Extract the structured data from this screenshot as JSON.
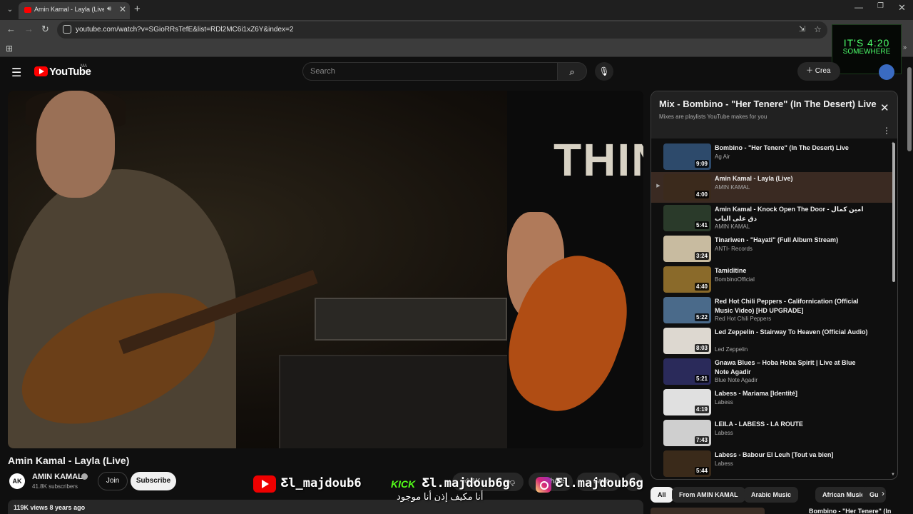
{
  "browser": {
    "tab_title": "Amin Kamal - Layla (Live) -",
    "url": "youtube.com/watch?v=SGioRRsTefE&list=RDl2MC6i1xZ6Y&index=2"
  },
  "overlay": {
    "line1": "IT'S 4:20",
    "line2": "SOMEWHERE"
  },
  "header": {
    "logo_text": "YouTube",
    "country": "MA",
    "search_placeholder": "Search",
    "create_label": "Crea"
  },
  "video": {
    "shirt_text": "THIN",
    "title": "Amin Kamal - Layla (Live)",
    "channel": {
      "avatar_text": "AK",
      "name": "AMIN KAMAL",
      "subscribers": "41.8K subscribers",
      "join_label": "Join",
      "subscribe_label": "Subscribe"
    },
    "actions": {
      "like": "1K",
      "share": "Share",
      "save": "Save"
    },
    "meta": "119K views  8 years ago"
  },
  "watermark": {
    "yt_handle": "Ƹl_majdoub6",
    "kick_label": "KICK",
    "kick_handle": "Ƹl.majdoub6g",
    "ig_handle": "Ƹl.majdoub6g",
    "arabic": "أنا مكيف إذن أنا موجود"
  },
  "playlist": {
    "title": "Mix - Bombino - \"Her Tenere\" (In The Desert) Live",
    "subtitle": "Mixes are playlists YouTube makes for you",
    "items": [
      {
        "title": "Bombino - \"Her Tenere\" (In The Desert) Live",
        "channel": "Ag Air",
        "duration": "9:09",
        "color": "#2d4a6b"
      },
      {
        "title": "Amin Kamal - Layla (Live)",
        "channel": "AMIN KAMAL",
        "duration": "4:00",
        "color": "#3b2a1c",
        "active": true
      },
      {
        "title": "Amin Kamal - Knock Open The Door امين كمال - دق على الباب",
        "channel": "AMIN KAMAL",
        "duration": "5:41",
        "color": "#2a3a2a"
      },
      {
        "title": "Tinariwen - \"Hayati\" (Full Album Stream)",
        "channel": "ANTI- Records",
        "duration": "3:24",
        "color": "#c8bba0"
      },
      {
        "title": "Tamiditine",
        "channel": "BombinoOfficial",
        "duration": "4:40",
        "color": "#8a6a2a"
      },
      {
        "title": "Red Hot Chili Peppers - Californication (Official Music Video) [HD UPGRADE]",
        "channel": "Red Hot Chili Peppers",
        "duration": "5:22",
        "color": "#4a6a8a"
      },
      {
        "title": "Led Zeppelin - Stairway To Heaven (Official Audio)",
        "channel": "Led Zeppelin",
        "duration": "8:03",
        "color": "#ddd8d0"
      },
      {
        "title": "Gnawa Blues – Hoba Hoba Spirit | Live at Blue Note Agadir",
        "channel": "Blue Note Agadir",
        "duration": "5:21",
        "color": "#2a2a5a"
      },
      {
        "title": "Labess - Mariama [Identité]",
        "channel": "Labess",
        "duration": "4:19",
        "color": "#e0e0e0"
      },
      {
        "title": "LEILA - LABESS - LA ROUTE",
        "channel": "Labess",
        "duration": "7:43",
        "color": "#cfcfcf"
      },
      {
        "title": "Labess - Babour El Leuh [Tout va bien]",
        "channel": "Labess",
        "duration": "5:44",
        "color": "#3a2a1a"
      }
    ]
  },
  "chips": [
    "All",
    "From AMIN KAMAL",
    "Arabic Music",
    "African Music",
    "Gu"
  ],
  "next_peek_title": "Bombino - \"Her Tenere\" (In"
}
